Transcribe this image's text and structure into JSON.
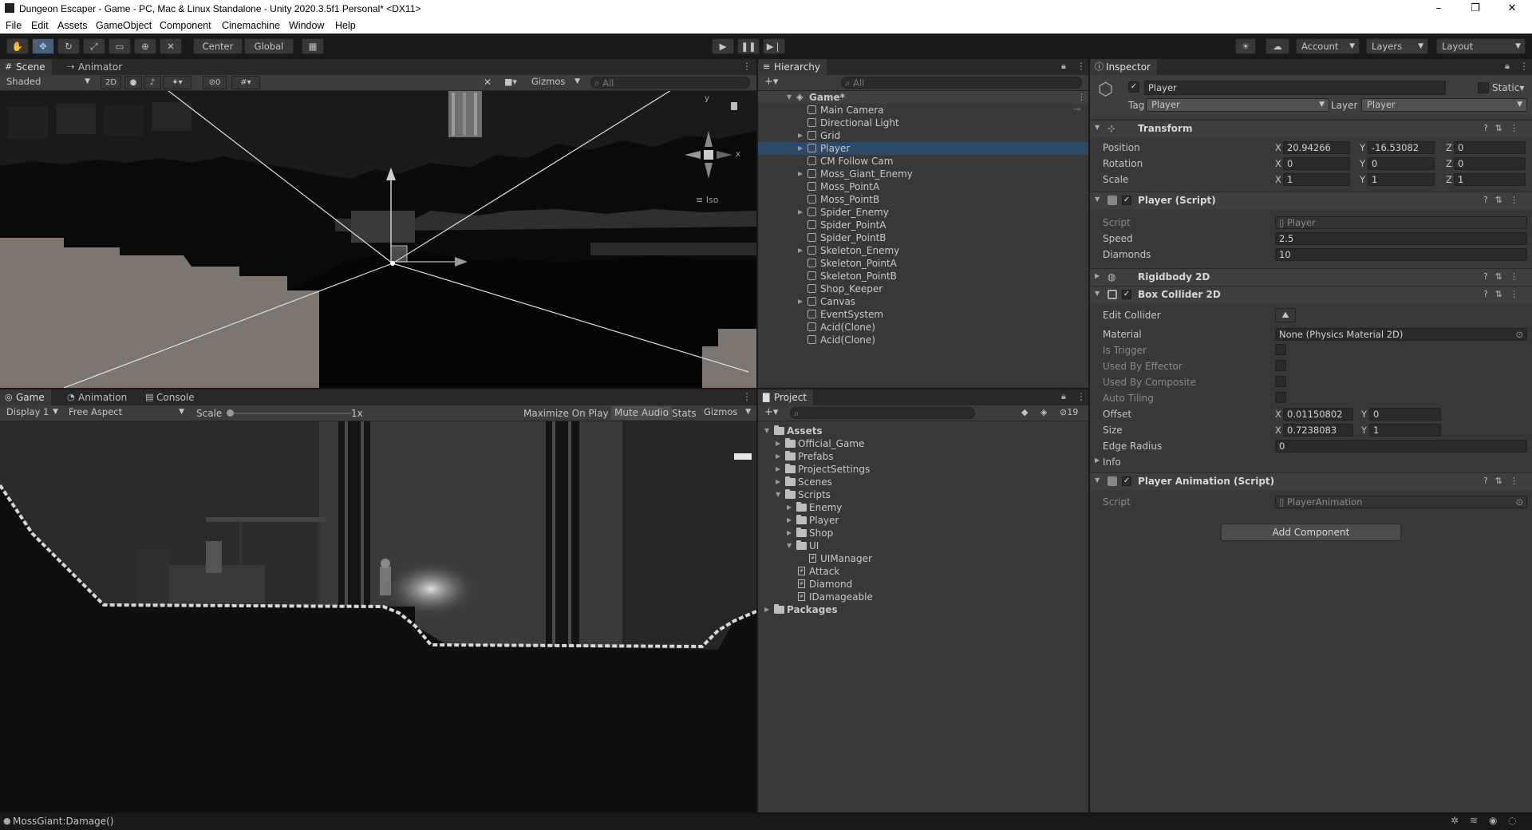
{
  "window": {
    "title": "Dungeon Escaper - Game - PC, Mac & Linux Standalone - Unity 2020.3.5f1 Personal* <DX11>",
    "minimize": "–",
    "restore": "❐",
    "close": "✕"
  },
  "menu": [
    "File",
    "Edit",
    "Assets",
    "GameObject",
    "Component",
    "Cinemachine",
    "Window",
    "Help"
  ],
  "toolbar": {
    "pivot": "Center",
    "space": "Global",
    "account": "Account",
    "layers": "Layers",
    "layout": "Layout"
  },
  "scene": {
    "tabs": [
      "Scene",
      "Animator"
    ],
    "shading": "Shaded",
    "mode_2d": "2D",
    "hidden_count": "0",
    "gizmos": "Gizmos",
    "search_placeholder": "All",
    "iso_label": "Iso",
    "gizmo_y": "y",
    "gizmo_x": "x"
  },
  "game": {
    "tabs": [
      "Game",
      "Animation",
      "Console"
    ],
    "display": "Display 1",
    "aspect": "Free Aspect",
    "scale_label": "Scale",
    "scale_value": "1x",
    "maximize": "Maximize On Play",
    "mute": "Mute Audio",
    "stats": "Stats",
    "gizmos": "Gizmos"
  },
  "hierarchy": {
    "tab": "Hierarchy",
    "search_placeholder": "All",
    "scene_name": "Game*",
    "items": [
      {
        "name": "Main Camera",
        "fold": false
      },
      {
        "name": "Directional Light",
        "fold": false
      },
      {
        "name": "Grid",
        "fold": true
      },
      {
        "name": "Player",
        "fold": true,
        "selected": true
      },
      {
        "name": "CM Follow Cam",
        "fold": false
      },
      {
        "name": "Moss_Giant_Enemy",
        "fold": true
      },
      {
        "name": "Moss_PointA",
        "fold": false
      },
      {
        "name": "Moss_PointB",
        "fold": false
      },
      {
        "name": "Spider_Enemy",
        "fold": true
      },
      {
        "name": "Spider_PointA",
        "fold": false
      },
      {
        "name": "Spider_PointB",
        "fold": false
      },
      {
        "name": "Skeleton_Enemy",
        "fold": true
      },
      {
        "name": "Skeleton_PointA",
        "fold": false
      },
      {
        "name": "Skeleton_PointB",
        "fold": false
      },
      {
        "name": "Shop_Keeper",
        "fold": false
      },
      {
        "name": "Canvas",
        "fold": true
      },
      {
        "name": "EventSystem",
        "fold": false
      },
      {
        "name": "Acid(Clone)",
        "fold": false
      },
      {
        "name": "Acid(Clone)",
        "fold": false
      }
    ]
  },
  "project": {
    "tab": "Project",
    "hidden_count": "19",
    "tree": [
      {
        "name": "Assets",
        "level": 0,
        "type": "folder",
        "open": true,
        "bold": true
      },
      {
        "name": "Official_Game",
        "level": 1,
        "type": "folder",
        "open": false
      },
      {
        "name": "Prefabs",
        "level": 1,
        "type": "folder",
        "open": false
      },
      {
        "name": "ProjectSettings",
        "level": 1,
        "type": "folder",
        "open": false
      },
      {
        "name": "Scenes",
        "level": 1,
        "type": "folder",
        "open": false
      },
      {
        "name": "Scripts",
        "level": 1,
        "type": "folder",
        "open": true
      },
      {
        "name": "Enemy",
        "level": 2,
        "type": "folder",
        "open": false
      },
      {
        "name": "Player",
        "level": 2,
        "type": "folder",
        "open": false
      },
      {
        "name": "Shop",
        "level": 2,
        "type": "folder",
        "open": false
      },
      {
        "name": "UI",
        "level": 2,
        "type": "folder",
        "open": true
      },
      {
        "name": "UIManager",
        "level": 3,
        "type": "script"
      },
      {
        "name": "Attack",
        "level": 2,
        "type": "script"
      },
      {
        "name": "Diamond",
        "level": 2,
        "type": "script"
      },
      {
        "name": "IDamageable",
        "level": 2,
        "type": "script"
      },
      {
        "name": "Packages",
        "level": 0,
        "type": "folder",
        "open": false,
        "bold": true
      }
    ]
  },
  "inspector": {
    "tab": "Inspector",
    "object_name": "Player",
    "static_label": "Static",
    "tag_label": "Tag",
    "tag_value": "Player",
    "layer_label": "Layer",
    "layer_value": "Player",
    "transform": {
      "title": "Transform",
      "position_label": "Position",
      "position": {
        "x": "20.94266",
        "y": "-16.53082",
        "z": "0"
      },
      "rotation_label": "Rotation",
      "rotation": {
        "x": "0",
        "y": "0",
        "z": "0"
      },
      "scale_label": "Scale",
      "scale": {
        "x": "1",
        "y": "1",
        "z": "1"
      }
    },
    "player_script": {
      "title": "Player (Script)",
      "script_label": "Script",
      "script_value": "Player",
      "speed_label": "Speed",
      "speed_value": "2.5",
      "diamonds_label": "Diamonds",
      "diamonds_value": "10"
    },
    "rigidbody": {
      "title": "Rigidbody 2D"
    },
    "box_collider": {
      "title": "Box Collider 2D",
      "edit_collider": "Edit Collider",
      "material_label": "Material",
      "material_value": "None (Physics Material 2D)",
      "is_trigger": "Is Trigger",
      "used_by_effector": "Used By Effector",
      "used_by_composite": "Used By Composite",
      "auto_tiling": "Auto Tiling",
      "offset_label": "Offset",
      "offset": {
        "x": "0.01150802",
        "y": "0"
      },
      "size_label": "Size",
      "size": {
        "x": "0.7238083",
        "y": "1"
      },
      "edge_radius_label": "Edge Radius",
      "edge_radius": "0",
      "info": "Info"
    },
    "anim_script": {
      "title": "Player Animation (Script)",
      "script_label": "Script",
      "script_value": "PlayerAnimation"
    },
    "add_component": "Add Component"
  },
  "status": {
    "message": "MossGiant:Damage()"
  },
  "colors": {
    "selection": "#2d4a6a",
    "panel": "#383838",
    "editor_bg": "#191919"
  }
}
